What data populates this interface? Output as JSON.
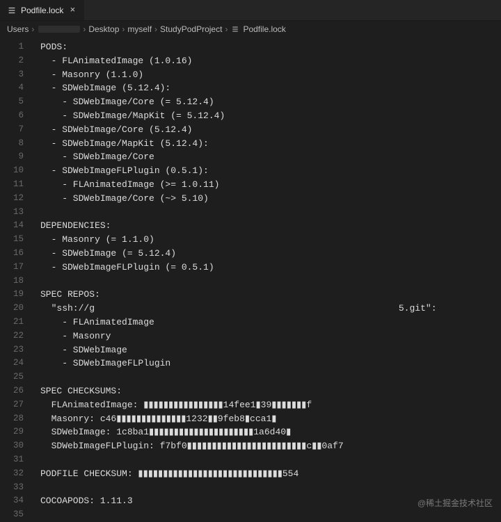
{
  "tab": {
    "label": "Podfile.lock",
    "icon": "list-icon"
  },
  "breadcrumb": {
    "items": [
      {
        "label": "Users"
      },
      {
        "label": "",
        "obscured": true
      },
      {
        "label": "Desktop"
      },
      {
        "label": "myself"
      },
      {
        "label": "StudyPodProject"
      },
      {
        "label": "Podfile.lock",
        "icon": "list-icon"
      }
    ]
  },
  "code_lines": [
    "PODS:",
    "  - FLAnimatedImage (1.0.16)",
    "  - Masonry (1.1.0)",
    "  - SDWebImage (5.12.4):",
    "    - SDWebImage/Core (= 5.12.4)",
    "    - SDWebImage/MapKit (= 5.12.4)",
    "  - SDWebImage/Core (5.12.4)",
    "  - SDWebImage/MapKit (5.12.4):",
    "    - SDWebImage/Core",
    "  - SDWebImageFLPlugin (0.5.1):",
    "    - FLAnimatedImage (>= 1.0.11)",
    "    - SDWebImage/Core (~> 5.10)",
    "",
    "DEPENDENCIES:",
    "  - Masonry (= 1.1.0)",
    "  - SDWebImage (= 5.12.4)",
    "  - SDWebImageFLPlugin (= 0.5.1)",
    "",
    "SPEC REPOS:",
    "  \"ssh://g                                                        5.git\":",
    "    - FLAnimatedImage",
    "    - Masonry",
    "    - SDWebImage",
    "    - SDWebImageFLPlugin",
    "",
    "SPEC CHECKSUMS:",
    "  FLAnimatedImage: ▮▮▮▮▮▮▮▮▮▮▮▮▮▮▮▮14fee1▮39▮▮▮▮▮▮▮f",
    "  Masonry: c46▮▮▮▮▮▮▮▮▮▮▮▮▮▮1232▮▮9feb8▮cca1▮",
    "  SDWebImage: 1c8ba1▮▮▮▮▮▮▮▮▮▮▮▮▮▮▮▮▮▮▮▮▮1a6d40▮",
    "  SDWebImageFLPlugin: f7bf0▮▮▮▮▮▮▮▮▮▮▮▮▮▮▮▮▮▮▮▮▮▮▮▮c▮▮0af7",
    "",
    "PODFILE CHECKSUM: ▮▮▮▮▮▮▮▮▮▮▮▮▮▮▮▮▮▮▮▮▮▮▮▮▮▮▮▮▮554",
    "",
    "COCOAPODS: 1.11.3",
    ""
  ],
  "watermark": "@稀土掘金技术社区"
}
